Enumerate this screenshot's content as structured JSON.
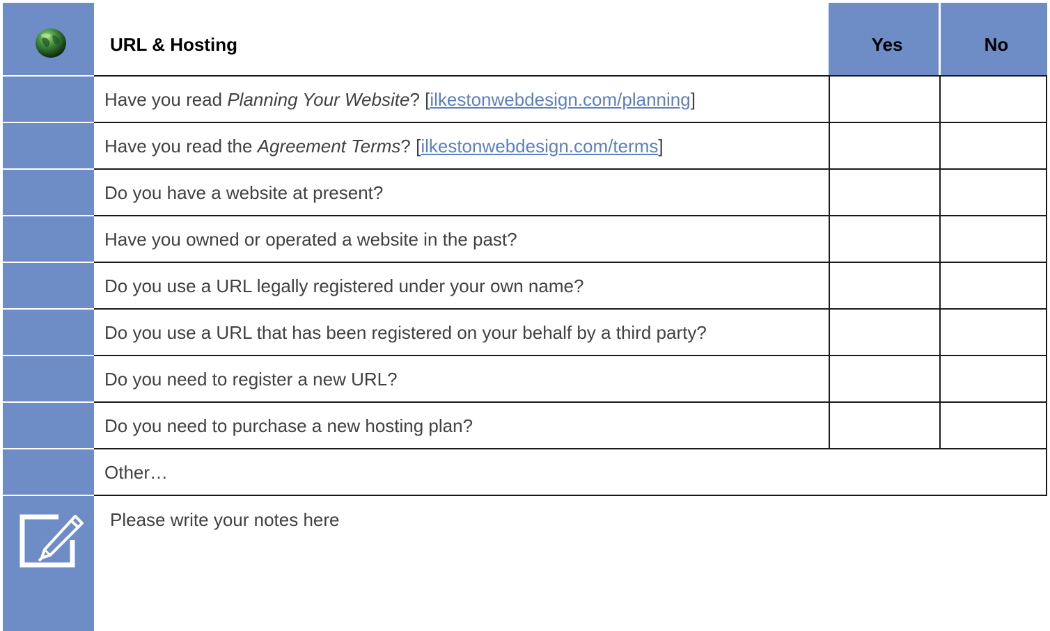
{
  "header": {
    "title": "URL & Hosting",
    "yes_label": "Yes",
    "no_label": "No",
    "logo_icon": "globe-icon"
  },
  "colors": {
    "accent": "#6e8cc6",
    "link": "#5b7fc4",
    "text": "#404040",
    "border": "#1a1a1a"
  },
  "questions": [
    {
      "prefix": "Have you read ",
      "italic": "Planning Your Website",
      "suffix": "? [",
      "link": "ilkestonwebdesign.com/planning",
      "end": "]"
    },
    {
      "prefix": "Have you read the ",
      "italic": "Agreement Terms",
      "suffix": "? [",
      "link": "ilkestonwebdesign.com/terms",
      "end": "]"
    },
    {
      "text": "Do you have a website at present?"
    },
    {
      "text": "Have you owned or operated a website in the past?"
    },
    {
      "text": "Do you use a URL legally registered under your own name?"
    },
    {
      "text": "Do you use a URL that has been registered on your behalf by a third party?"
    },
    {
      "text": "Do you need to register a new URL?"
    },
    {
      "text": "Do you need to purchase a new hosting plan?"
    }
  ],
  "other_label": "Other…",
  "notes": {
    "placeholder": "Please write your notes here",
    "icon": "edit-notes-icon"
  }
}
